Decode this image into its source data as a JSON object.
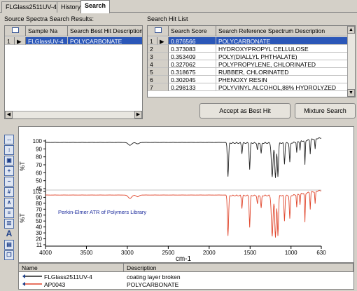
{
  "tabs": [
    {
      "label": "FLGlass2511UV-4",
      "active": false
    },
    {
      "label": "History",
      "active": false
    },
    {
      "label": "Search",
      "active": true
    }
  ],
  "source_panel": {
    "title": "Source Spectra Search Results:",
    "columns": [
      "Sample Na",
      "Search Best Hit Description"
    ],
    "rows": [
      {
        "num": "1",
        "sample": "FLGlassUV-4",
        "description": "POLYCARBONATE"
      }
    ]
  },
  "hit_panel": {
    "title": "Search Hit List",
    "columns": [
      "Search Score",
      "Search Reference Spectrum Description"
    ],
    "rows": [
      {
        "num": "1",
        "score": "0.876566",
        "description": "POLYCARBONATE"
      },
      {
        "num": "2",
        "score": "0.373083",
        "description": "HYDROXYPROPYL CELLULOSE"
      },
      {
        "num": "3",
        "score": "0.353409",
        "description": "POLY(DIALLYL PHTHALATE)"
      },
      {
        "num": "4",
        "score": "0.327062",
        "description": "POLYPROPYLENE, CHLORINATED"
      },
      {
        "num": "5",
        "score": "0.318675",
        "description": "RUBBER, CHLORINATED"
      },
      {
        "num": "6",
        "score": "0.302045",
        "description": "PHENOXY RESIN"
      },
      {
        "num": "7",
        "score": "0.298133",
        "description": "POLYVINYL ALCOHOL,88% HYDROLYZED"
      }
    ],
    "accept_label": "Accept as Best Hit",
    "mixture_label": "Mixture Search"
  },
  "plot": {
    "annotation": "Perkin-Elmer ATR of Polymers Library",
    "x_title": "cm-1",
    "x_ticks": [
      "4000",
      "3500",
      "3000",
      "2500",
      "2000",
      "1500",
      "1000",
      "630"
    ],
    "top_y_title": "%T",
    "top_y_ticks": [
      "100",
      "90",
      "80",
      "70",
      "60",
      "50",
      "45"
    ],
    "bottom_y_title": "%T",
    "bottom_y_ticks": [
      "102",
      "90",
      "80",
      "70",
      "60",
      "50",
      "40",
      "30",
      "20",
      "11"
    ],
    "colors": {
      "top_trace": "#222222",
      "bottom_trace": "#e0452b",
      "annotation": "#1a2a9c"
    }
  },
  "legend": {
    "columns": [
      "Name",
      "Description"
    ],
    "rows": [
      {
        "name": "FLGlass2511UV-4",
        "description": "coating layer broken",
        "color": "#222222"
      },
      {
        "name": "AP0043",
        "description": "POLYCARBONATE",
        "color": "#e0452b"
      }
    ]
  },
  "toolbar_icons": [
    "zoom-x-icon",
    "zoom-y-icon",
    "zoom-box-icon",
    "zoom-in-icon",
    "zoom-out-icon",
    "grid-icon",
    "peak-icon",
    "overlay-icon",
    "stack-icon",
    "text-icon",
    "print-icon",
    "copy-icon"
  ]
}
